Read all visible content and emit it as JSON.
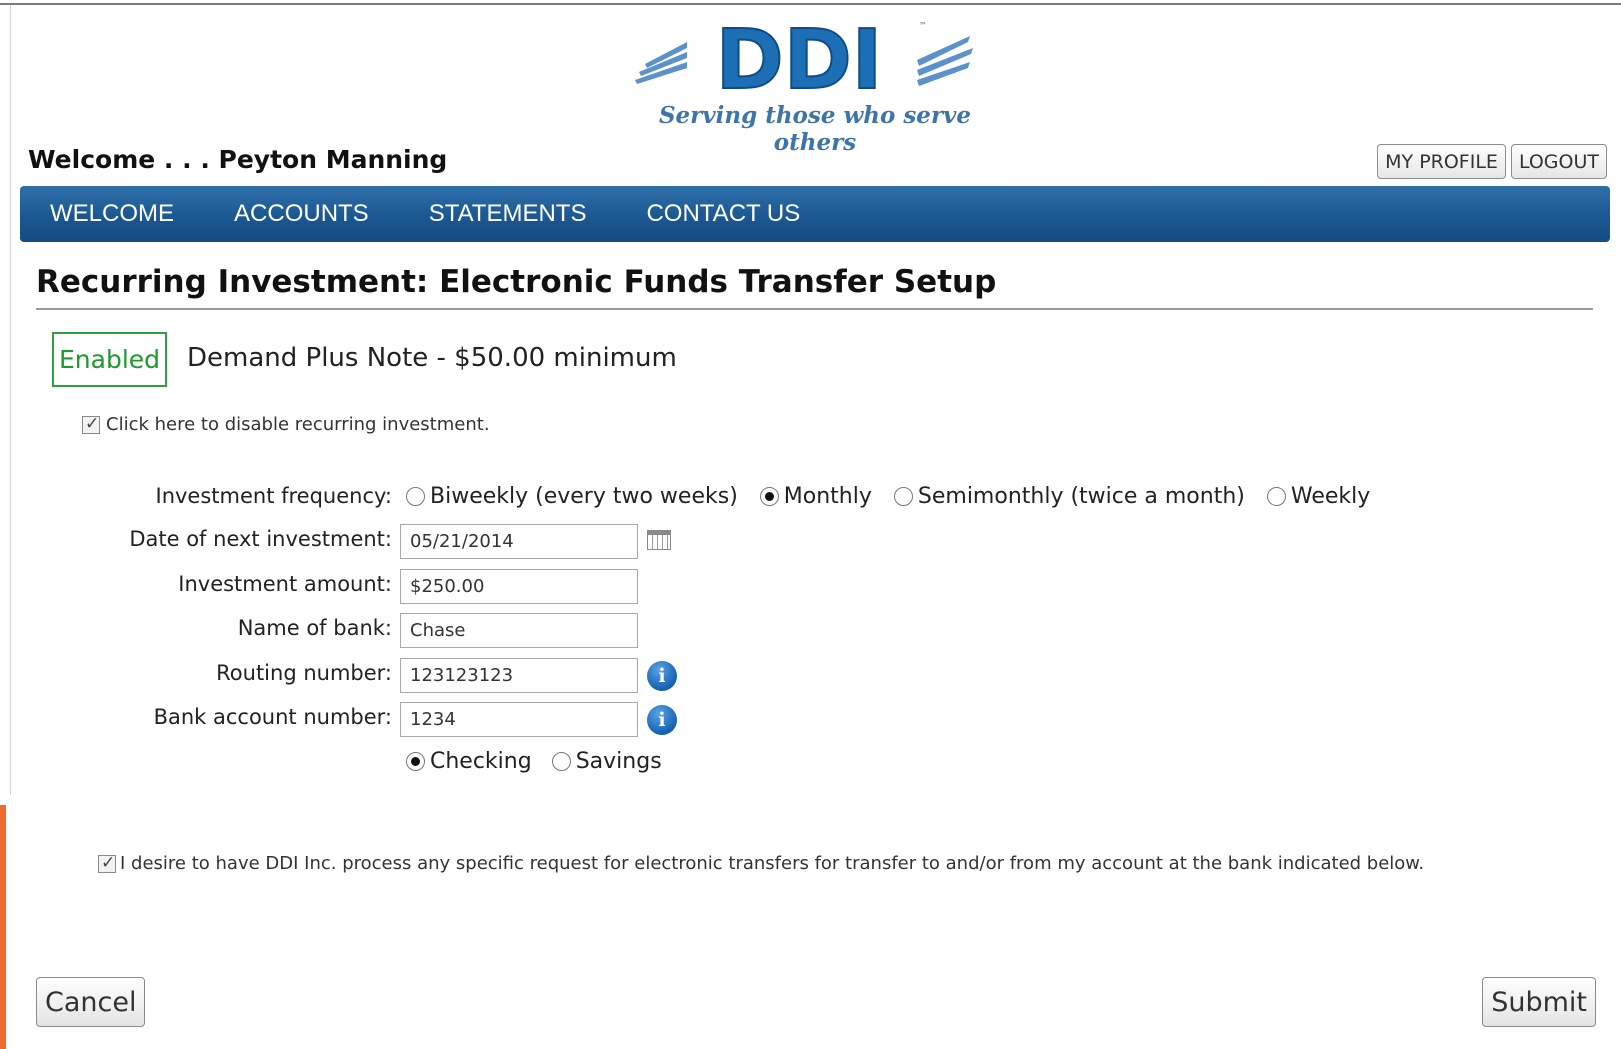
{
  "brand": {
    "logo_text": "DDI",
    "tagline": "Serving those who serve others",
    "logo_color": "#1c6fb4"
  },
  "header": {
    "welcome_text": "Welcome . . . Peyton Manning",
    "my_profile_label": "MY PROFILE",
    "logout_label": "LOGOUT"
  },
  "nav": {
    "items": [
      {
        "label": "WELCOME"
      },
      {
        "label": "ACCOUNTS"
      },
      {
        "label": "STATEMENTS"
      },
      {
        "label": "CONTACT US"
      }
    ],
    "bar_color": "#1a5690"
  },
  "page": {
    "title": "Recurring Investment: Electronic Funds Transfer Setup",
    "status_badge": "Enabled",
    "status_color": "#1f9a30",
    "product_label": "Demand Plus Note - $50.00 minimum",
    "disable_checkbox_label": "Click here to disable recurring investment.",
    "disable_checked": true
  },
  "form": {
    "frequency_label": "Investment frequency:",
    "frequency_options": [
      {
        "label": "Biweekly (every two weeks)",
        "selected": false
      },
      {
        "label": "Monthly",
        "selected": true
      },
      {
        "label": "Semimonthly (twice a month)",
        "selected": false
      },
      {
        "label": "Weekly",
        "selected": false
      }
    ],
    "next_date_label": "Date of next investment:",
    "next_date_value": "05/21/2014",
    "amount_label": "Investment amount:",
    "amount_value": "$250.00",
    "bank_name_label": "Name of bank:",
    "bank_name_value": "Chase",
    "routing_label": "Routing number:",
    "routing_value": "123123123",
    "account_label": "Bank account number:",
    "account_value": "1234",
    "account_type_options": [
      {
        "label": "Checking",
        "selected": true
      },
      {
        "label": "Savings",
        "selected": false
      }
    ],
    "consent_label": "I desire to have DDI Inc. process any specific request for electronic transfers for transfer to and/or from my account at the bank indicated below.",
    "consent_checked": true
  },
  "actions": {
    "cancel_label": "Cancel",
    "submit_label": "Submit"
  }
}
